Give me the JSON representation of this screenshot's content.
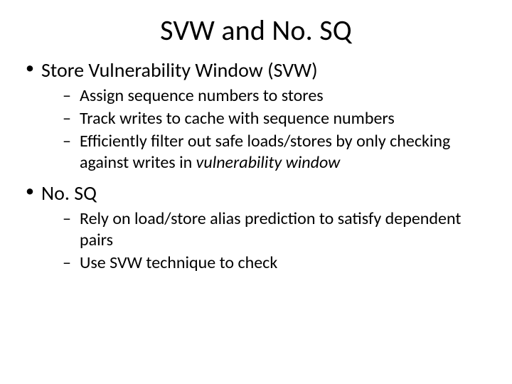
{
  "title": "SVW and No. SQ",
  "bullets": [
    {
      "text": "Store Vulnerability Window (SVW)",
      "children": [
        {
          "text": "Assign sequence numbers to stores"
        },
        {
          "text": "Track writes to cache with sequence numbers"
        },
        {
          "prefix": "Efficiently filter out safe loads/stores by only checking against writes in ",
          "emph": "vulnerability window"
        }
      ]
    },
    {
      "text": "No. SQ",
      "children": [
        {
          "text": "Rely on load/store alias prediction to satisfy dependent pairs"
        },
        {
          "text": "Use SVW technique to check"
        }
      ]
    }
  ]
}
